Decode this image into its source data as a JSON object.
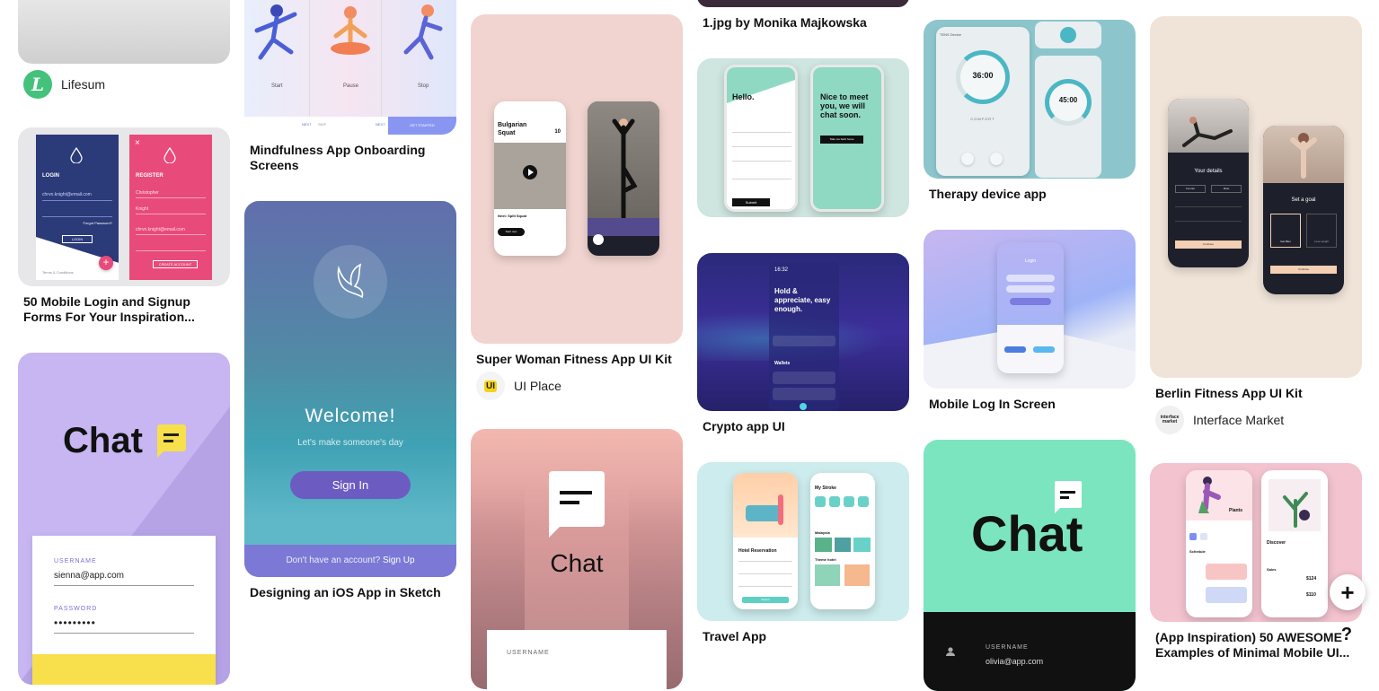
{
  "pins": {
    "p1": {
      "source": "Lifesum",
      "avatar_letter": "L"
    },
    "p2": {
      "title": "50 Mobile Login and Signup Forms For Your Inspiration...",
      "login_label": "LOGIN",
      "register_label": "REGISTER",
      "email": "chrvn.knight@email.com",
      "forgot": "Forgot Password?",
      "login_btn": "LOGIN",
      "create_btn": "CREATE ACCOUNT",
      "terms": "Terms & Conditions",
      "first_name": "Christopher",
      "last_name": "Knight"
    },
    "p3": {
      "chat": "Chat",
      "username_label": "USERNAME",
      "username": "sienna@app.com",
      "password_label": "PASSWORD",
      "password": "•••••••••"
    },
    "p4": {
      "title": "Mindfulness App Onboarding Screens",
      "step1": "Start",
      "step2": "Pause",
      "step3": "Stop",
      "next": "NEXT",
      "skip": "SKIP",
      "get_started": "GET STARTED"
    },
    "p5": {
      "title": "Designing an iOS App in Sketch",
      "welcome": "Welcome!",
      "subtitle": "Let's make someone's day",
      "sign_in": "Sign In",
      "no_account": "Don't have an account?",
      "sign_up": "Sign Up"
    },
    "p6": {
      "title": "Super Woman Fitness App UI Kit",
      "source": "UI Place",
      "avatar_letter": "UI",
      "exercise": "Bulgarian Squat",
      "count": "10",
      "next": "Next: Split Squat",
      "start": "Start now"
    },
    "p7": {
      "chat": "Chat",
      "username_label": "USERNAME"
    },
    "p8": {
      "title": "1.jpg by Monika Majkowska"
    },
    "p9": {
      "hello": "Hello.",
      "nice": "Nice to meet you, we will chat soon.",
      "submit": "Submit",
      "take_back": "Take me back home"
    },
    "p10": {
      "title": "Crypto app UI",
      "time": "16:32",
      "headline": "Hold & appreciate, easy enough.",
      "wallets": "Wallets"
    },
    "p11": {
      "title": "Travel App",
      "my_stroke": "My Stroke",
      "hotel": "Hotel Reservation",
      "malaysia": "Malaysia",
      "theme_hotel": "Theme hotel",
      "submit": "Submit"
    },
    "p12": {
      "title": "Therapy device app",
      "time1": "36:00",
      "time2": "45:00",
      "device": "TENS Device",
      "comfort": "COMFORT"
    },
    "p13": {
      "title": "Mobile Log In Screen",
      "login": "Login"
    },
    "p14": {
      "chat": "Chat",
      "username_label": "USERNAME",
      "username": "olivia@app.com"
    },
    "p15": {
      "title": "Berlin Fitness App UI Kit",
      "source": "Interface Market",
      "avatar_text": "interface market",
      "your_details": "Your details",
      "set_goal": "Set a goal",
      "female": "Female",
      "male": "Male",
      "continue": "Continue",
      "get_fitter": "Get fitter",
      "lose_weight": "Lose weight"
    },
    "p16": {
      "title": "(App Inspiration) 50 AWESOME Examples of Minimal Mobile UI...",
      "plants": "Plants",
      "discover": "Discover",
      "schedule": "Schedule",
      "sales": "Sales",
      "price1": "$124",
      "price2": "$110"
    }
  },
  "controls": {
    "add": "+",
    "help": "?"
  },
  "colors": {
    "brand_green": "#44c17b",
    "chat_yellow": "#f7e04b",
    "chat_purple": "#c7b6f2",
    "mint": "#7be5bf"
  }
}
